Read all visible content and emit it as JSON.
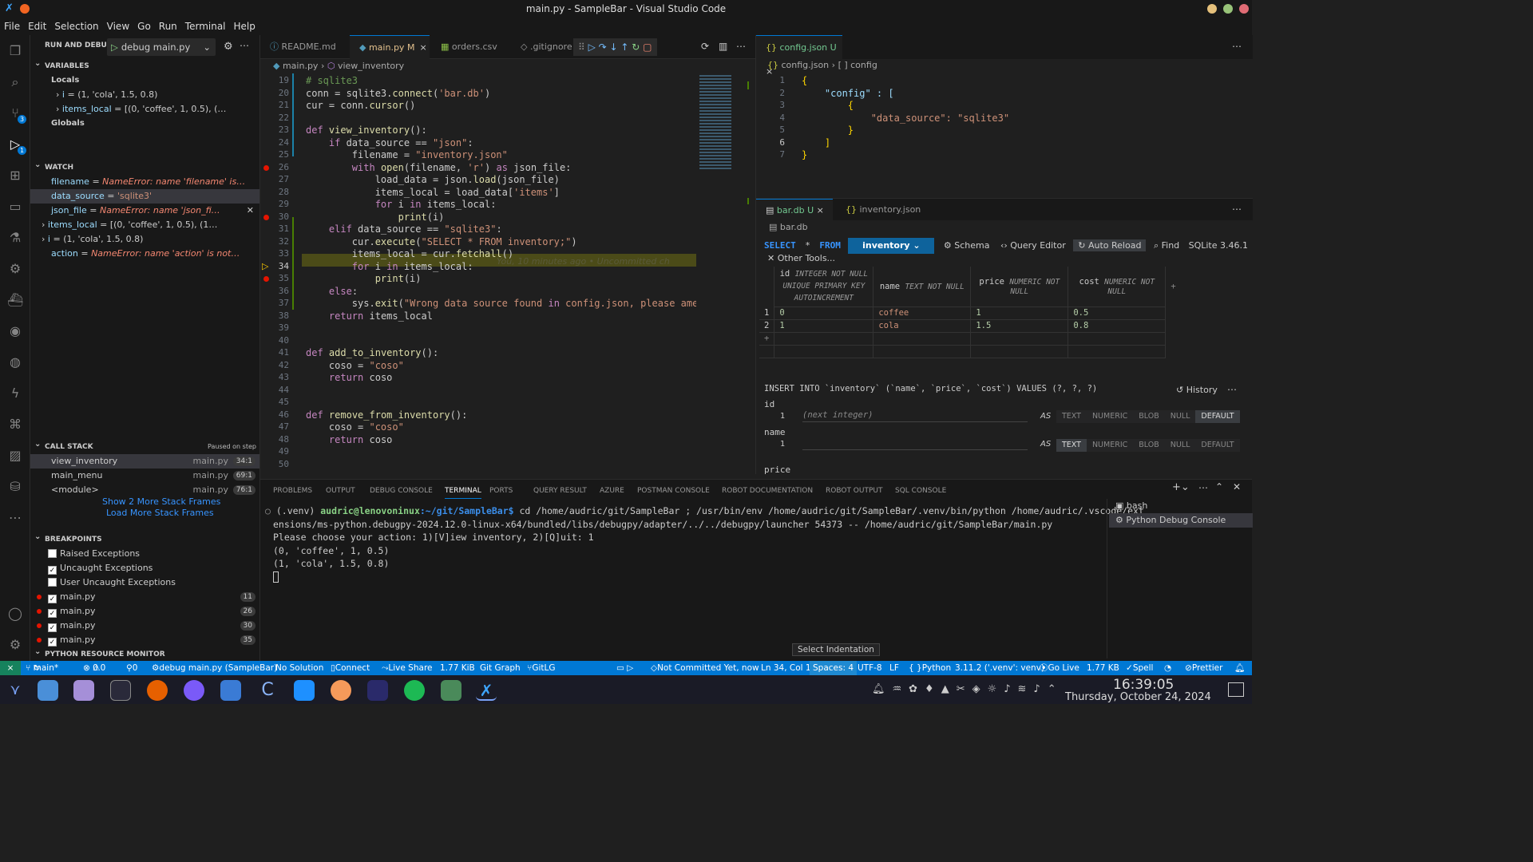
{
  "window": {
    "title": "main.py - SampleBar - Visual Studio Code"
  },
  "menu": [
    "File",
    "Edit",
    "Selection",
    "View",
    "Go",
    "Run",
    "Terminal",
    "Help"
  ],
  "debug": {
    "header": "RUN AND DEBUG",
    "config": "debug main.py"
  },
  "variables": {
    "title": "VARIABLES",
    "locals_label": "Locals",
    "globals_label": "Globals",
    "locals": [
      {
        "name": "i",
        "value": "(1, 'cola', 1.5, 0.8)"
      },
      {
        "name": "items_local",
        "value": "[(0, 'coffee', 1, 0.5), (…"
      }
    ]
  },
  "watch": {
    "title": "WATCH",
    "items": [
      {
        "name": "filename",
        "value": "NameError: name 'filename' is…",
        "error": true
      },
      {
        "name": "data_source",
        "value": "'sqlite3'",
        "error": false
      },
      {
        "name": "json_file",
        "value": "NameError: name 'json_fi…",
        "error": true
      },
      {
        "name": "items_local",
        "value": "[(0, 'coffee', 1, 0.5), (1…",
        "error": false
      },
      {
        "name": "i",
        "value": "(1, 'cola', 1.5, 0.8)",
        "error": false
      },
      {
        "name": "action",
        "value": "NameError: name 'action' is not…",
        "error": true
      }
    ]
  },
  "callstack": {
    "title": "CALL STACK",
    "status": "Paused on step",
    "frames": [
      {
        "fn": "view_inventory",
        "file": "main.py",
        "line": "34:1"
      },
      {
        "fn": "main_menu",
        "file": "main.py",
        "line": "69:1"
      },
      {
        "fn": "<module>",
        "file": "main.py",
        "line": "76:1"
      }
    ],
    "more": "Show 2 More Stack Frames",
    "load": "Load More Stack Frames"
  },
  "breakpoints": {
    "title": "BREAKPOINTS",
    "options": [
      {
        "label": "Raised Exceptions",
        "checked": false
      },
      {
        "label": "Uncaught Exceptions",
        "checked": true
      },
      {
        "label": "User Uncaught Exceptions",
        "checked": false
      }
    ],
    "files": [
      {
        "file": "main.py",
        "line": "11"
      },
      {
        "file": "main.py",
        "line": "26"
      },
      {
        "file": "main.py",
        "line": "30"
      },
      {
        "file": "main.py",
        "line": "35"
      }
    ]
  },
  "resource_monitor": "PYTHON RESOURCE MONITOR",
  "tabs": [
    {
      "label": "README.md"
    },
    {
      "label": "main.py M"
    },
    {
      "label": "orders.csv"
    },
    {
      "label": ".gitignore"
    }
  ],
  "breadcrumb": {
    "file": "main.py",
    "symbol": "view_inventory"
  },
  "code_lines": [
    {
      "n": "19",
      "t": "# sqlite3"
    },
    {
      "n": "20",
      "t": "conn = sqlite3.connect('bar.db')"
    },
    {
      "n": "21",
      "t": "cur = conn.cursor()"
    },
    {
      "n": "22",
      "t": ""
    },
    {
      "n": "23",
      "t": "def view_inventory():"
    },
    {
      "n": "24",
      "t": "    if data_source == \"json\":"
    },
    {
      "n": "25",
      "t": "        filename = \"inventory.json\""
    },
    {
      "n": "26",
      "t": "        with open(filename, 'r') as json_file:"
    },
    {
      "n": "27",
      "t": "            load_data = json.load(json_file)"
    },
    {
      "n": "28",
      "t": "            items_local = load_data['items']"
    },
    {
      "n": "29",
      "t": "            for i in items_local:"
    },
    {
      "n": "30",
      "t": "                print(i)"
    },
    {
      "n": "31",
      "t": "    elif data_source == \"sqlite3\":"
    },
    {
      "n": "32",
      "t": "        cur.execute(\"SELECT * FROM inventory;\")"
    },
    {
      "n": "33",
      "t": "        items_local = cur.fetchall()"
    },
    {
      "n": "34",
      "t": "        for i in items_local:"
    },
    {
      "n": "35",
      "t": "            print(i)"
    },
    {
      "n": "36",
      "t": "    else:"
    },
    {
      "n": "37",
      "t": "        sys.exit(\"Wrong data source found in config.json, please amend"
    },
    {
      "n": "38",
      "t": "    return items_local"
    },
    {
      "n": "39",
      "t": ""
    },
    {
      "n": "40",
      "t": ""
    },
    {
      "n": "41",
      "t": "def add_to_inventory():"
    },
    {
      "n": "42",
      "t": "    coso = \"coso\""
    },
    {
      "n": "43",
      "t": "    return coso"
    },
    {
      "n": "44",
      "t": ""
    },
    {
      "n": "45",
      "t": ""
    },
    {
      "n": "46",
      "t": "def remove_from_inventory():"
    },
    {
      "n": "47",
      "t": "    coso = \"coso\""
    },
    {
      "n": "48",
      "t": "    return coso"
    },
    {
      "n": "49",
      "t": ""
    },
    {
      "n": "50",
      "t": ""
    }
  ],
  "blame": "You, 10 minutes ago • Uncommitted ch",
  "config_tab": "config.json U",
  "config_crumb": {
    "file": "config.json",
    "symbol": "[ ] config"
  },
  "config_lines": [
    {
      "n": "1",
      "t": "{"
    },
    {
      "n": "2",
      "t": "    \"config\" : ["
    },
    {
      "n": "3",
      "t": "        {"
    },
    {
      "n": "4",
      "t": "            \"data_source\": \"sqlite3\""
    },
    {
      "n": "5",
      "t": "        }"
    },
    {
      "n": "6",
      "t": "    ]"
    },
    {
      "n": "7",
      "t": "}"
    }
  ],
  "db_tabs": [
    {
      "label": "bar.db U"
    },
    {
      "label": "inventory.json"
    }
  ],
  "db": {
    "crumb": "bar.db",
    "select": "SELECT",
    "star": "*",
    "from": "FROM",
    "table": "inventory",
    "schema": "Schema",
    "query_editor": "Query Editor",
    "auto_reload": "Auto Reload",
    "find": "Find",
    "version": "SQLite 3.46.1",
    "other_tools": "Other Tools...",
    "columns": [
      {
        "name": "id",
        "type": "INTEGER NOT NULL UNIQUE PRIMARY KEY AUTOINCREMENT"
      },
      {
        "name": "name",
        "type": "TEXT NOT NULL"
      },
      {
        "name": "price",
        "type": "NUMERIC NOT NULL"
      },
      {
        "name": "cost",
        "type": "NUMERIC NOT NULL"
      }
    ],
    "rows": [
      [
        "1",
        "0",
        "coffee",
        "1",
        "0.5"
      ],
      [
        "2",
        "1",
        "cola",
        "1.5",
        "0.8"
      ]
    ],
    "insert": "INSERT INTO `inventory` (`name`, `price`, `cost`) VALUES (?, ?, ?)",
    "history": "History",
    "field_id": "id",
    "field_name": "name",
    "field_price": "price",
    "next_integer": "(next integer)",
    "as": "AS",
    "types": [
      "TEXT",
      "NUMERIC",
      "BLOB",
      "NULL",
      "DEFAULT"
    ]
  },
  "panel_tabs": [
    "PROBLEMS",
    "OUTPUT",
    "DEBUG CONSOLE",
    "TERMINAL",
    "PORTS",
    "QUERY RESULT",
    "AZURE",
    "POSTMAN CONSOLE",
    "ROBOT DOCUMENTATION",
    "ROBOT OUTPUT",
    "SQL CONSOLE"
  ],
  "terminal": {
    "prompt_user": "audric@lenovoninux",
    "prompt_path": ":~/git/SampleBar$",
    "cmd": " cd /home/audric/git/SampleBar ; /usr/bin/env /home/audric/git/SampleBar/.venv/bin/python /home/audric/.vscode/ext",
    "lines": [
      "ensions/ms-python.debugpy-2024.12.0-linux-x64/bundled/libs/debugpy/adapter/../../debugpy/launcher 54373 -- /home/audric/git/SampleBar/main.py",
      "Please choose your action: 1)[V]iew inventory, 2)[Q]uit: 1",
      "(0, 'coffee', 1, 0.5)",
      "(1, 'cola', 1.5, 0.8)"
    ],
    "venv": "(.venv) ",
    "sessions": [
      "bash",
      "Python Debug Console"
    ]
  },
  "tooltip": "Select Indentation",
  "status": {
    "branch": "main*",
    "errors": "0",
    "warnings": "0",
    "ports": "0",
    "debug": "debug main.py (SampleBar)",
    "solution": "No Solution",
    "connect": "Connect",
    "liveshare": "Live Share",
    "size1": "1.77 KiB",
    "gitgraph": "Git Graph",
    "gitlg": "GitLG",
    "blame": "Not Committed Yet, now",
    "pos": "Ln 34, Col 1",
    "spaces": "Spaces: 4",
    "enc": "UTF-8",
    "eol": "LF",
    "lang": "Python",
    "interp": "3.11.2 ('.venv': venv)",
    "golive": "Go Live",
    "size2": "1.77 KB",
    "spell": "Spell",
    "prettier": "Prettier"
  },
  "clock": {
    "time": "16:39:05",
    "date": "Thursday, October 24, 2024"
  }
}
